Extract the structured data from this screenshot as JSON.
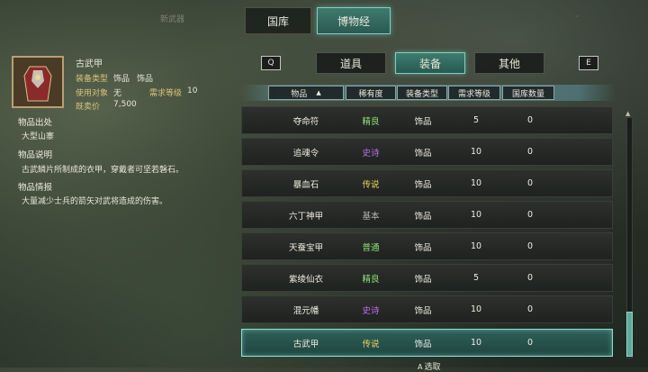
{
  "tabs": {
    "main": [
      "国库",
      "博物经"
    ],
    "active_main": 1,
    "corner_left_faded": "新武器",
    "corner_right_faded": "·"
  },
  "item": {
    "name": "古武甲",
    "type_label": "装备类型",
    "type_value": "饰品",
    "type_value2": "饰品",
    "use_label": "使用对象",
    "use_value": "无",
    "req_label": "需求等级",
    "req_value": "10",
    "price_label": "既卖价",
    "price_value": "7,500",
    "origin_title": "物品出处",
    "origin_text": "大型山寨",
    "desc_title": "物品说明",
    "desc_text": "古武鳞片所制成的衣甲，穿戴者可坚若磐石。",
    "info_title": "物品情报",
    "info_text": "大量减少士兵的箭矢对武将造成的伤害。"
  },
  "subtabs": {
    "left_key": "Q",
    "right_key": "E",
    "labels": [
      "道具",
      "装备",
      "其他"
    ],
    "active": 1
  },
  "table": {
    "headers": [
      "物品",
      "稀有度",
      "装备类型",
      "需求等级",
      "国库数量"
    ],
    "sort_icon": "▲",
    "rows": [
      {
        "name": "夺命符",
        "rarity": "精良",
        "rarity_color": "#8fe27a",
        "type": "饰品",
        "level": "5",
        "count": "0"
      },
      {
        "name": "追魂令",
        "rarity": "史诗",
        "rarity_color": "#c070ee",
        "type": "饰品",
        "level": "10",
        "count": "0"
      },
      {
        "name": "暴血石",
        "rarity": "传说",
        "rarity_color": "#f0d45a",
        "type": "饰品",
        "level": "10",
        "count": "0"
      },
      {
        "name": "六丁神甲",
        "rarity": "基本",
        "rarity_color": "#b8b5aa",
        "type": "饰品",
        "level": "10",
        "count": "0"
      },
      {
        "name": "天蚕宝甲",
        "rarity": "普通",
        "rarity_color": "#8fe27a",
        "type": "饰品",
        "level": "10",
        "count": "0"
      },
      {
        "name": "紫绫仙衣",
        "rarity": "精良",
        "rarity_color": "#8fe27a",
        "type": "饰品",
        "level": "5",
        "count": "0"
      },
      {
        "name": "混元幡",
        "rarity": "史诗",
        "rarity_color": "#c070ee",
        "type": "饰品",
        "level": "10",
        "count": "0"
      },
      {
        "name": "古武甲",
        "rarity": "传说",
        "rarity_color": "#f0d45a",
        "type": "饰品",
        "level": "10",
        "count": "0"
      }
    ],
    "selected_row": 7
  },
  "bottom_hint": "选取",
  "bottom_hint_key": "A"
}
